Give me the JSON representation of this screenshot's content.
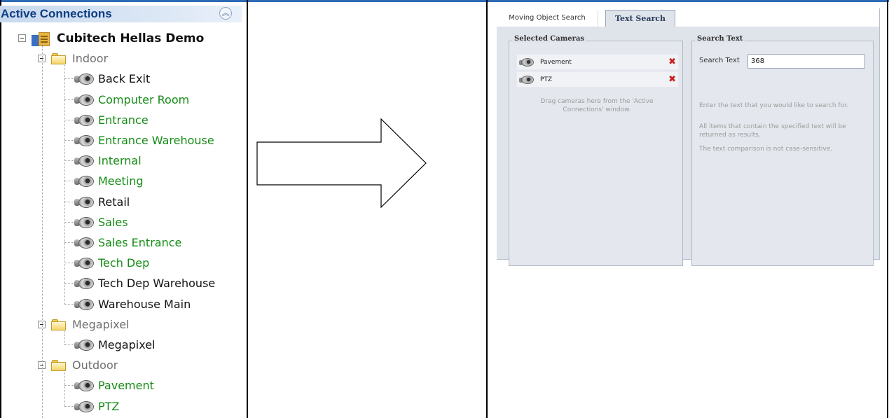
{
  "panel": {
    "title": "Active Connections",
    "collapse_icon": "chevrons-up-icon"
  },
  "tree": {
    "root": "Cubitech Hellas Demo",
    "folders": [
      {
        "label": "Indoor",
        "cameras": [
          {
            "label": "Back Exit",
            "color": "#111111"
          },
          {
            "label": "Computer Room",
            "color": "#168c16"
          },
          {
            "label": "Entrance",
            "color": "#168c16"
          },
          {
            "label": "Entrance Warehouse",
            "color": "#168c16"
          },
          {
            "label": "Internal",
            "color": "#168c16"
          },
          {
            "label": "Meeting",
            "color": "#168c16"
          },
          {
            "label": "Retail",
            "color": "#111111"
          },
          {
            "label": "Sales",
            "color": "#168c16"
          },
          {
            "label": "Sales Entrance",
            "color": "#168c16"
          },
          {
            "label": "Tech Dep",
            "color": "#168c16"
          },
          {
            "label": "Tech Dep Warehouse",
            "color": "#111111"
          },
          {
            "label": "Warehouse Main",
            "color": "#111111"
          }
        ]
      },
      {
        "label": "Megapixel",
        "cameras": [
          {
            "label": "Megapixel",
            "color": "#111111"
          }
        ]
      },
      {
        "label": "Outdoor",
        "cameras": [
          {
            "label": "Pavement",
            "color": "#168c16"
          },
          {
            "label": "PTZ",
            "color": "#168c16"
          }
        ]
      }
    ]
  },
  "search": {
    "tabs": [
      "Moving Object Search",
      "Text Search"
    ],
    "active_tab": "Text Search",
    "selected_cameras": {
      "title": "Selected Cameras",
      "items": [
        "Pavement",
        "PTZ"
      ],
      "hint": "Drag cameras here from the 'Active Connections' window."
    },
    "search_text": {
      "title": "Search Text",
      "label": "Search Text",
      "value": "368",
      "help1": "Enter the text that you would like to search for.",
      "help2": "All items that contain the specified text will be returned as results.",
      "help3": "The text comparison is not case-sensitive."
    }
  },
  "colors": {
    "accent": "#2d6bb5",
    "active_green": "#168c16",
    "remove_red": "#cc1f1f"
  }
}
